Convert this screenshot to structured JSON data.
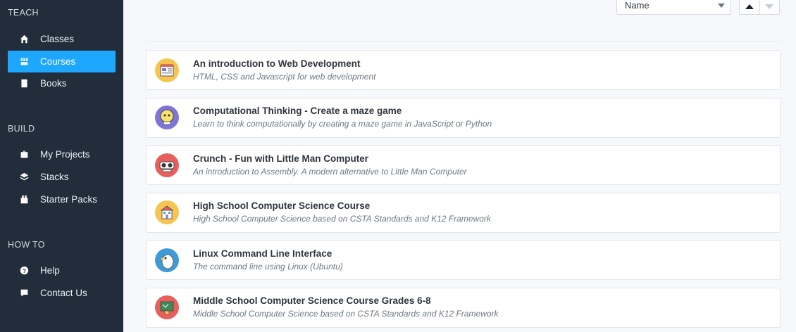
{
  "sidebar": {
    "sections": [
      {
        "title": "TEACH",
        "items": [
          {
            "label": "Classes",
            "icon": "home-icon",
            "active": false
          },
          {
            "label": "Courses",
            "icon": "courses-icon",
            "active": true
          },
          {
            "label": "Books",
            "icon": "book-icon",
            "active": false
          }
        ]
      },
      {
        "title": "BUILD",
        "items": [
          {
            "label": "My Projects",
            "icon": "briefcase-icon",
            "active": false
          },
          {
            "label": "Stacks",
            "icon": "layers-icon",
            "active": false
          },
          {
            "label": "Starter Packs",
            "icon": "package-icon",
            "active": false
          }
        ]
      },
      {
        "title": "HOW TO",
        "items": [
          {
            "label": "Help",
            "icon": "help-icon",
            "active": false
          },
          {
            "label": "Contact Us",
            "icon": "chat-bubble-icon",
            "active": false
          }
        ]
      }
    ]
  },
  "toolbar": {
    "sort_value": "Name",
    "order_up_icon": "sort-ascending-icon",
    "order_down_icon": "sort-descending-icon"
  },
  "courses": [
    {
      "title": "An introduction to Web Development",
      "description": "HTML, CSS and Javascript for web development",
      "icon": "web-browser-icon",
      "icon_bg": "#f5c451"
    },
    {
      "title": "Computational Thinking - Create a maze game",
      "description": "Learn to think computationally by creating a maze game in JavaScript or Python",
      "icon": "robot-face-icon",
      "icon_bg": "#7f75d8"
    },
    {
      "title": "Crunch - Fun with Little Man Computer",
      "description": "An introduction to Assembly. A modern alternative to Little Man Computer",
      "icon": "goggles-robot-icon",
      "icon_bg": "#e8605b"
    },
    {
      "title": "High School Computer Science Course",
      "description": "High School Computer Science based on CSTA Standards and K12 Framework",
      "icon": "school-building-icon",
      "icon_bg": "#f5c451"
    },
    {
      "title": "Linux Command Line Interface",
      "description": "The command line using Linux (Ubuntu)",
      "icon": "penguin-icon",
      "icon_bg": "#3f9ad6"
    },
    {
      "title": "Middle School Computer Science Course Grades 6-8",
      "description": "Middle School Computer Science based on CSTA Standards and K12 Framework",
      "icon": "chalkboard-icon",
      "icon_bg": "#e8605b"
    }
  ]
}
